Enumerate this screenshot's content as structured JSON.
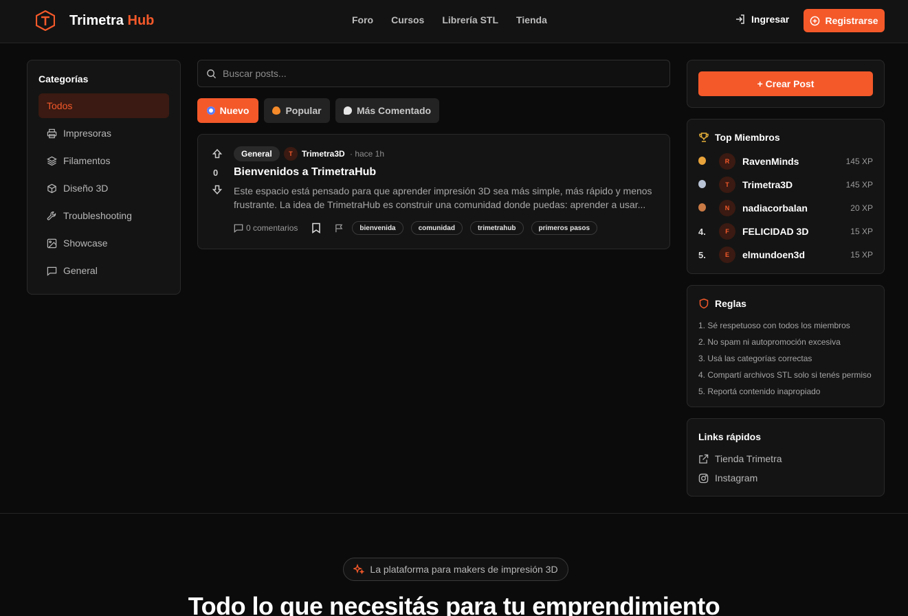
{
  "header": {
    "brand_main": "Trimetra",
    "brand_accent": "Hub",
    "nav": [
      "Foro",
      "Cursos",
      "Librería STL",
      "Tienda"
    ],
    "login_label": "Ingresar",
    "register_label": "Registrarse"
  },
  "categories": {
    "title": "Categorías",
    "items": [
      {
        "label": "Todos",
        "icon": "none"
      },
      {
        "label": "Impresoras",
        "icon": "printer-icon"
      },
      {
        "label": "Filamentos",
        "icon": "layers-icon"
      },
      {
        "label": "Diseño 3D",
        "icon": "cube-icon"
      },
      {
        "label": "Troubleshooting",
        "icon": "wrench-icon"
      },
      {
        "label": "Showcase",
        "icon": "image-icon"
      },
      {
        "label": "General",
        "icon": "message-icon"
      }
    ]
  },
  "search": {
    "placeholder": "Buscar posts..."
  },
  "sort": {
    "new": "Nuevo",
    "popular": "Popular",
    "most_commented": "Más Comentado"
  },
  "post": {
    "votes": "0",
    "category": "General",
    "author_initial": "T",
    "author": "Trimetra3D",
    "time": "· hace 1h",
    "title": "Bienvenidos a TrimetraHub",
    "body": "Este espacio está pensado para que aprender impresión 3D sea más simple, más rápido y menos frustrante. La idea de TrimetraHub es construir una comunidad donde puedas: aprender a usar...",
    "comments": "0 comentarios",
    "tags": [
      "bienvenida",
      "comunidad",
      "trimetrahub",
      "primeros pasos"
    ]
  },
  "sidebar_right": {
    "create_post": "+ Crear Post",
    "top_title": "Top Miembros",
    "members": [
      {
        "rank": "",
        "medal": "gold",
        "initial": "R",
        "name": "RavenMinds",
        "xp": "145 XP"
      },
      {
        "rank": "",
        "medal": "silver",
        "initial": "T",
        "name": "Trimetra3D",
        "xp": "145 XP"
      },
      {
        "rank": "",
        "medal": "bronze",
        "initial": "N",
        "name": "nadiacorbalan",
        "xp": "20 XP"
      },
      {
        "rank": "4.",
        "medal": "",
        "initial": "F",
        "name": "FELICIDAD 3D",
        "xp": "15 XP"
      },
      {
        "rank": "5.",
        "medal": "",
        "initial": "E",
        "name": "elmundoen3d",
        "xp": "15 XP"
      }
    ],
    "rules_title": "Reglas",
    "rules": [
      "1. Sé respetuoso con todos los miembros",
      "2. No spam ni autopromoción excesiva",
      "3. Usá las categorías correctas",
      "4. Compartí archivos STL solo si tenés permiso",
      "5. Reportá contenido inapropiado"
    ],
    "links_title": "Links rápidos",
    "links": [
      {
        "label": "Tienda Trimetra",
        "icon": "external-link-icon"
      },
      {
        "label": "Instagram",
        "icon": "instagram-icon"
      }
    ]
  },
  "hero": {
    "pill": "La plataforma para makers de impresión 3D",
    "heading": "Todo lo que necesitás para tu emprendimiento"
  },
  "colors": {
    "accent": "#f4592a",
    "background": "#0b0b0b",
    "panel": "#141414"
  }
}
